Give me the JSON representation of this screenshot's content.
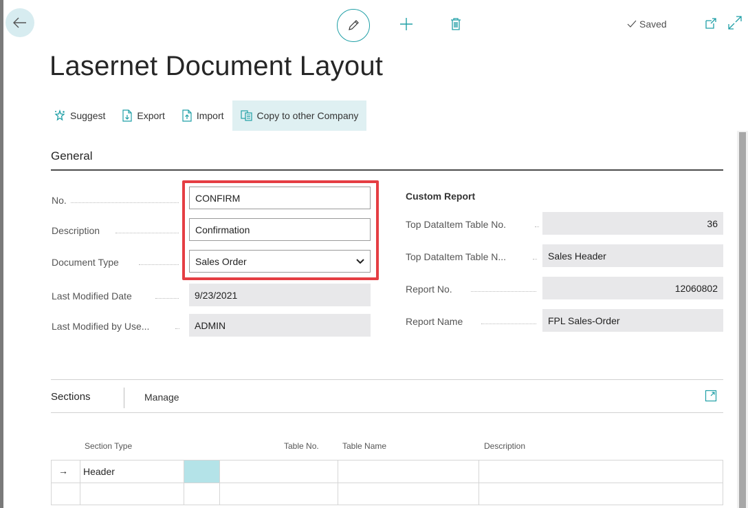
{
  "toolbar": {
    "saved_label": "Saved"
  },
  "page": {
    "title": "Lasernet Document Layout"
  },
  "actions": [
    {
      "label": "Suggest"
    },
    {
      "label": "Export"
    },
    {
      "label": "Import"
    },
    {
      "label": "Copy to other Company"
    }
  ],
  "general": {
    "title": "General",
    "no_label": "No.",
    "no_value": "CONFIRM",
    "description_label": "Description",
    "description_value": "Confirmation",
    "document_type_label": "Document Type",
    "document_type_value": "Sales Order",
    "last_modified_date_label": "Last Modified Date",
    "last_modified_date_value": "9/23/2021",
    "last_modified_by_label": "Last Modified by Use...",
    "last_modified_by_value": "ADMIN",
    "custom_report_title": "Custom Report",
    "top_table_no_label": "Top DataItem Table No.",
    "top_table_no_value": "36",
    "top_table_name_label": "Top DataItem Table N...",
    "top_table_name_value": "Sales Header",
    "report_no_label": "Report No.",
    "report_no_value": "12060802",
    "report_name_label": "Report Name",
    "report_name_value": "FPL Sales-Order"
  },
  "sections": {
    "title": "Sections",
    "manage_label": "Manage",
    "columns": [
      "Section Type",
      "Table No.",
      "Table Name",
      "Description"
    ],
    "rows": [
      {
        "marker": "→",
        "section_type": "Header",
        "table_no": "",
        "table_name": "",
        "description": ""
      },
      {
        "marker": "",
        "section_type": "",
        "table_no": "",
        "table_name": "",
        "description": ""
      }
    ]
  },
  "colors": {
    "accent": "#1f9fa6",
    "highlight": "#e53e43",
    "active_action_bg": "#dff0f2"
  }
}
